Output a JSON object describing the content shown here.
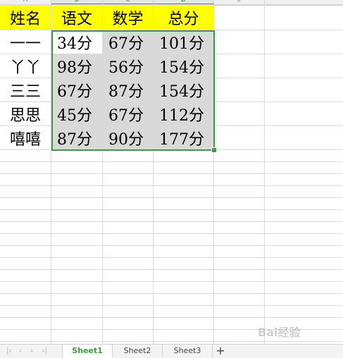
{
  "sheet": {
    "column_headers": [
      "A",
      "B",
      "C",
      "D",
      "E"
    ],
    "header_row": [
      "姓名",
      "语文",
      "数学",
      "总分"
    ],
    "rows": [
      {
        "name": "一一",
        "chinese": "34分",
        "math": "67分",
        "total": "101分"
      },
      {
        "name": "丫丫",
        "chinese": "98分",
        "math": "56分",
        "total": "154分"
      },
      {
        "name": "三三",
        "chinese": "67分",
        "math": "87分",
        "total": "154分"
      },
      {
        "name": "思思",
        "chinese": "45分",
        "math": "67分",
        "total": "112分"
      },
      {
        "name": "嘻嘻",
        "chinese": "87分",
        "math": "90分",
        "total": "177分"
      }
    ]
  },
  "colors": {
    "header_fill": "#ffff00",
    "selection_fill": "#d9d9d9",
    "selection_border": "#3f9a48",
    "active_tab_text": "#3aa03a"
  },
  "tabs": {
    "items": [
      {
        "label": "Sheet1",
        "active": true
      },
      {
        "label": "Sheet2",
        "active": false
      },
      {
        "label": "Sheet3",
        "active": false
      }
    ],
    "add_label": "+"
  },
  "icons": [
    "nav-first-icon",
    "nav-prev-icon",
    "nav-next-icon",
    "nav-last-icon",
    "add-sheet-icon"
  ],
  "watermark": "Bai经验"
}
